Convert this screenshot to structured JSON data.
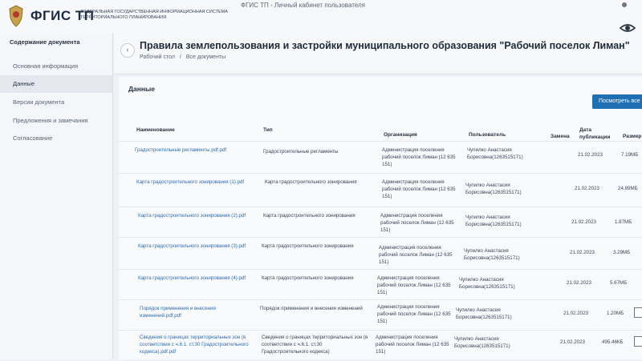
{
  "header": {
    "logo": "ФГИС ТП",
    "logo_subtitle": "ФЕДЕРАЛЬНАЯ ГОСУДАРСТВЕННАЯ ИНФОРМАЦИОННАЯ СИСТЕМА ТЕРРИТОРИАЛЬНОГО ПЛАНИРОВАНИЯ",
    "window_title": "ФГИС ТП - Личный кабинет пользователя"
  },
  "sidebar": {
    "title": "Содержание документа",
    "items": [
      {
        "label": "Основная информация"
      },
      {
        "label": "Данные"
      },
      {
        "label": "Версии документа"
      },
      {
        "label": "Предложения и замечания"
      },
      {
        "label": "Согласование"
      }
    ]
  },
  "page": {
    "title": "Правила землепользования и застройки муниципального образования \"Рабочий поселок Лиман\"",
    "breadcrumb": [
      "Рабочий стол",
      "/",
      "Все документы"
    ]
  },
  "data_section": {
    "title": "Данные",
    "view_all_button": "Посмотреть все",
    "columns": [
      "Наименование",
      "Тип",
      "Организация",
      "Пользователь",
      "Замена",
      "Дата публикации",
      "Размер"
    ],
    "rows": [
      {
        "name": "Градостроительные регламенты.pdf.pdf",
        "type": "Градостроительные регламенты",
        "org": "Администрация поселения рабочий поселок Лиман (12 635 151)",
        "user": "Чупилко Анастасия Борисовна(1263515171)",
        "date": "21.02.2023",
        "size": "7.19МБ"
      },
      {
        "name": "Карта градостроительного зонирования (1).pdf",
        "type": "Карта градостроительного зонирования",
        "org": "Администрация поселения рабочий поселок Лиман (12 635 151)",
        "user": "Чупилко Анастасия Борисовна(1263515171)",
        "date": "21.02.2023",
        "size": "24.89МБ"
      },
      {
        "name": "Карта градостроительного зонирования (2).pdf",
        "type": "Карта градостроительного зонирования",
        "org": "Администрация поселения рабочий поселок Лиман (12 635 151)",
        "user": "Чупилко Анастасия Борисовна(1263515171)",
        "date": "21.02.2023",
        "size": "1.87МБ"
      },
      {
        "name": "Карта градостроительного зонирования (3).pdf",
        "type": "Карта градостроительного зонирования",
        "org": "Администрация поселения рабочий поселок Лиман (12 635 151)",
        "user": "Чупилко Анастасия Борисовна(1263515171)",
        "date": "21.02.2023",
        "size": "3.29МБ"
      },
      {
        "name": "Карта градостроительного зонирования (4).pdf",
        "type": "Карта градостроительного зонирования",
        "org": "Администрация поселения рабочий поселок Лиман (12 635 151)",
        "user": "Чупилко Анастасия Борисовна(1263515171)",
        "date": "21.02.2023",
        "size": "5.67МБ"
      },
      {
        "name": "Порядок применения и внесения изменений.pdf.pdf",
        "type": "Порядок применения и внесения изменений",
        "org": "Администрация поселения рабочий поселок Лиман (12 635 151)",
        "user": "Чупилко Анастасия Борисовна(1263515171)",
        "date": "21.02.2023",
        "size": "1.20МБ"
      },
      {
        "name": "Сведения о границах территориальных зон (в соответствии с ч.6.1. ст.30 Градостроительного кодекса).pdf.pdf",
        "type": "Сведения о границах территориальных зон (в соответствии с ч.6.1. ст.30 Градостроительного кодекса)",
        "org": "Администрация поселения рабочий поселок Лиман (12 635 151)",
        "user": "Чупилко Анастасия Борисовна(1263515171)",
        "date": "21.02.2023",
        "size": "495.46КБ"
      }
    ]
  }
}
